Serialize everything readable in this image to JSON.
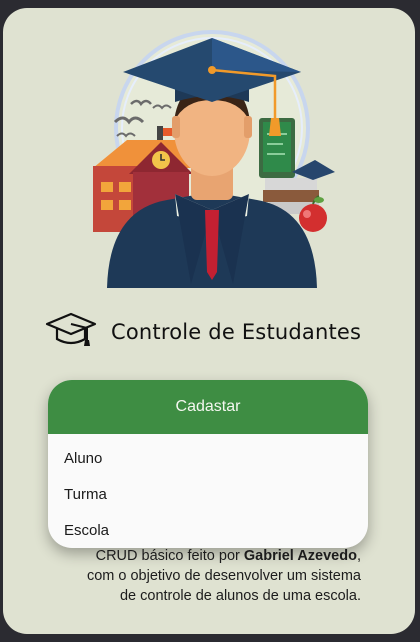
{
  "header": {
    "title": "Controle de Estudantes",
    "icon": "graduation-cap-icon"
  },
  "menu": {
    "title": "Cadastar",
    "items": [
      {
        "label": "Aluno"
      },
      {
        "label": "Turma"
      },
      {
        "label": "Escola"
      }
    ]
  },
  "footer": {
    "prefix": "CRUD básico feito por ",
    "author": "Gabriel Azevedo",
    "suffix": ",",
    "line2": "com o objetivo de desenvolver um sistema",
    "line3": "de controle de alunos de uma escola."
  },
  "colors": {
    "background": "#dfe2d1",
    "menu_header": "#3e8d43",
    "page_frame": "#2b2b31"
  }
}
